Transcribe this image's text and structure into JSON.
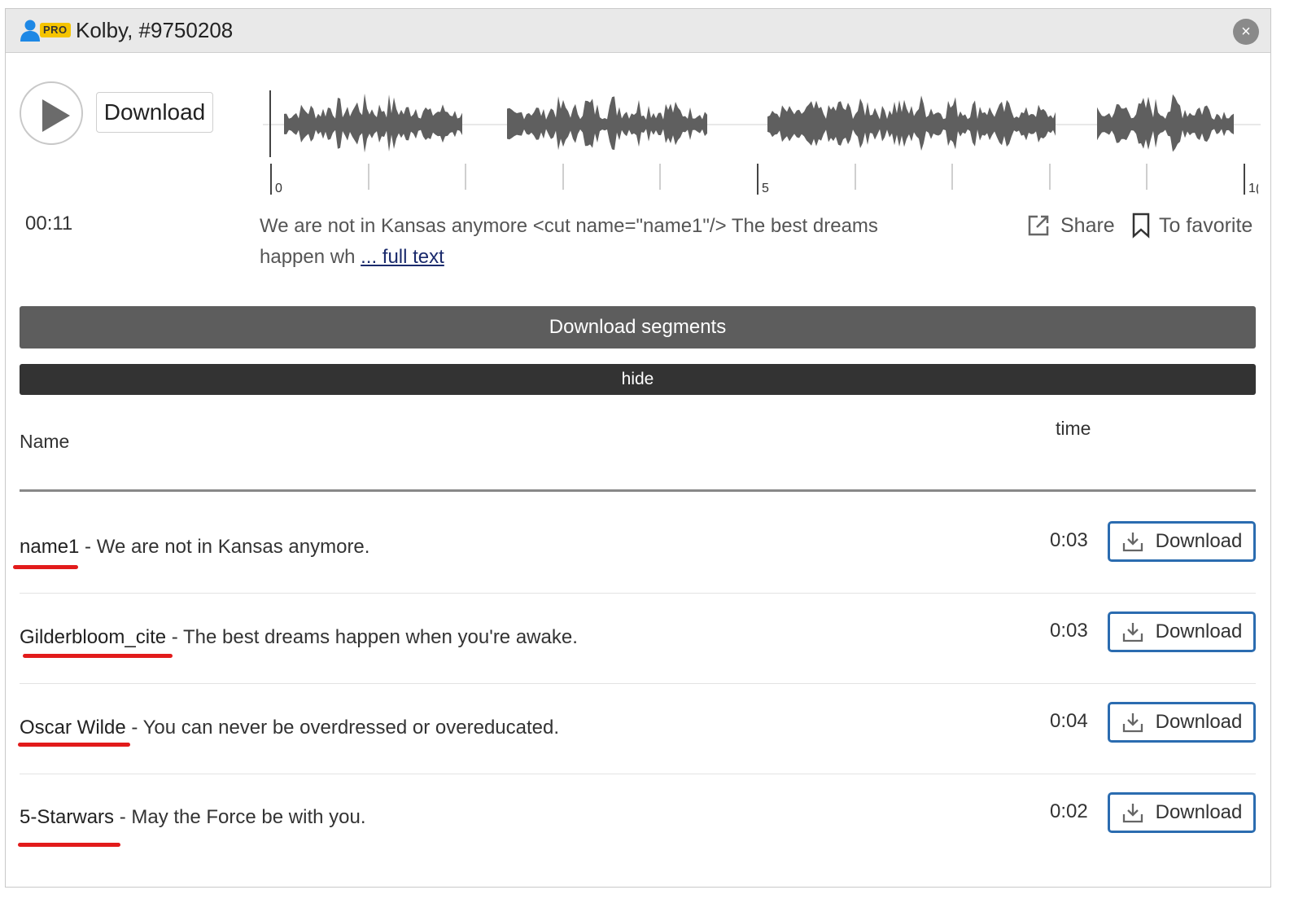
{
  "header": {
    "badge": "PRO",
    "title": "Kolby, #9750208",
    "close_label": "×",
    "user_icon": "user-icon"
  },
  "player": {
    "play_icon": "play-icon",
    "download_label": "Download",
    "duration": "00:11",
    "timeline_labels": [
      "0",
      "5",
      "1("
    ]
  },
  "preview": {
    "text": "We are not in Kansas anymore <cut name=\"name1\"/> The best dreams happen wh",
    "link_text": "... full text"
  },
  "actions": {
    "share_label": "Share",
    "favorite_label": "To favorite",
    "share_icon": "share-icon",
    "favorite_icon": "bookmark-icon"
  },
  "segments_button": "Download segments",
  "hide_button": "hide",
  "table": {
    "col_name": "Name",
    "col_time": "time",
    "rows": [
      {
        "name": "name1",
        "text": " - We are not in Kansas anymore.",
        "time": "0:03",
        "download": "Download"
      },
      {
        "name": "Gilderbloom_cite",
        "text": " - The best dreams happen when you're awake.",
        "time": "0:03",
        "download": "Download"
      },
      {
        "name": "Oscar Wilde",
        "text": " - You can never be overdressed or overeducated.",
        "time": "0:04",
        "download": "Download"
      },
      {
        "name": "5-Starwars",
        "text": " - May the Force be with you.",
        "time": "0:02",
        "download": "Download"
      }
    ]
  },
  "colors": {
    "annotation_underline": "#e21b1b",
    "download_border": "#2b6cb0",
    "segments_bg": "#5d5d5d",
    "hide_bg": "#333333",
    "pro_badge": "#f5c400"
  }
}
